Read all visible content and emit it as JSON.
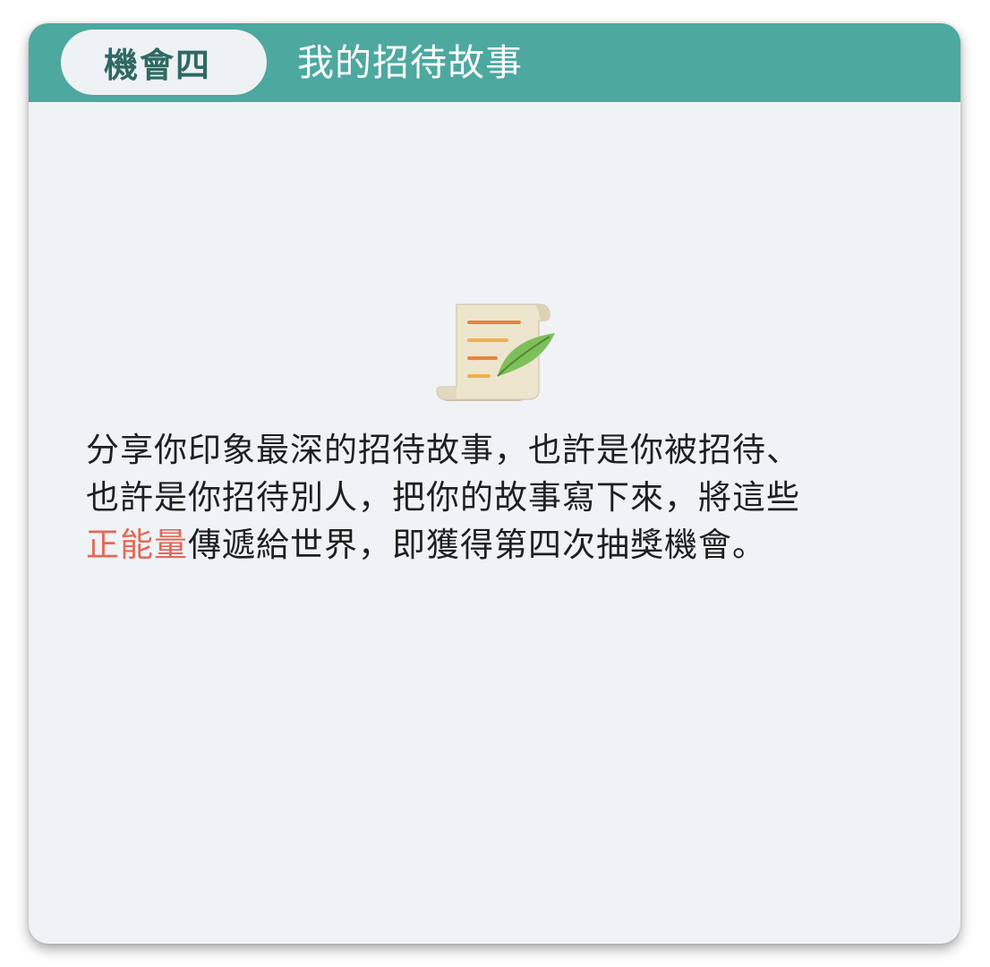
{
  "header": {
    "badge_label": "機會四",
    "title": "我的招待故事"
  },
  "content": {
    "icon": "scroll-with-quill-icon",
    "paragraph_line1": "分享你印象最深的招待故事，也許是你被招待、",
    "paragraph_line2": "也許是你招待別人，把你的故事寫下來，將這些",
    "highlight_text": "正能量",
    "paragraph_line3_rest": "傳遞給世界，即獲得第四次抽獎機會。"
  },
  "colors": {
    "header_bg": "#4da89f",
    "card_bg": "#f0f3f6",
    "badge_text": "#2f6963",
    "highlight": "#e2695a"
  }
}
